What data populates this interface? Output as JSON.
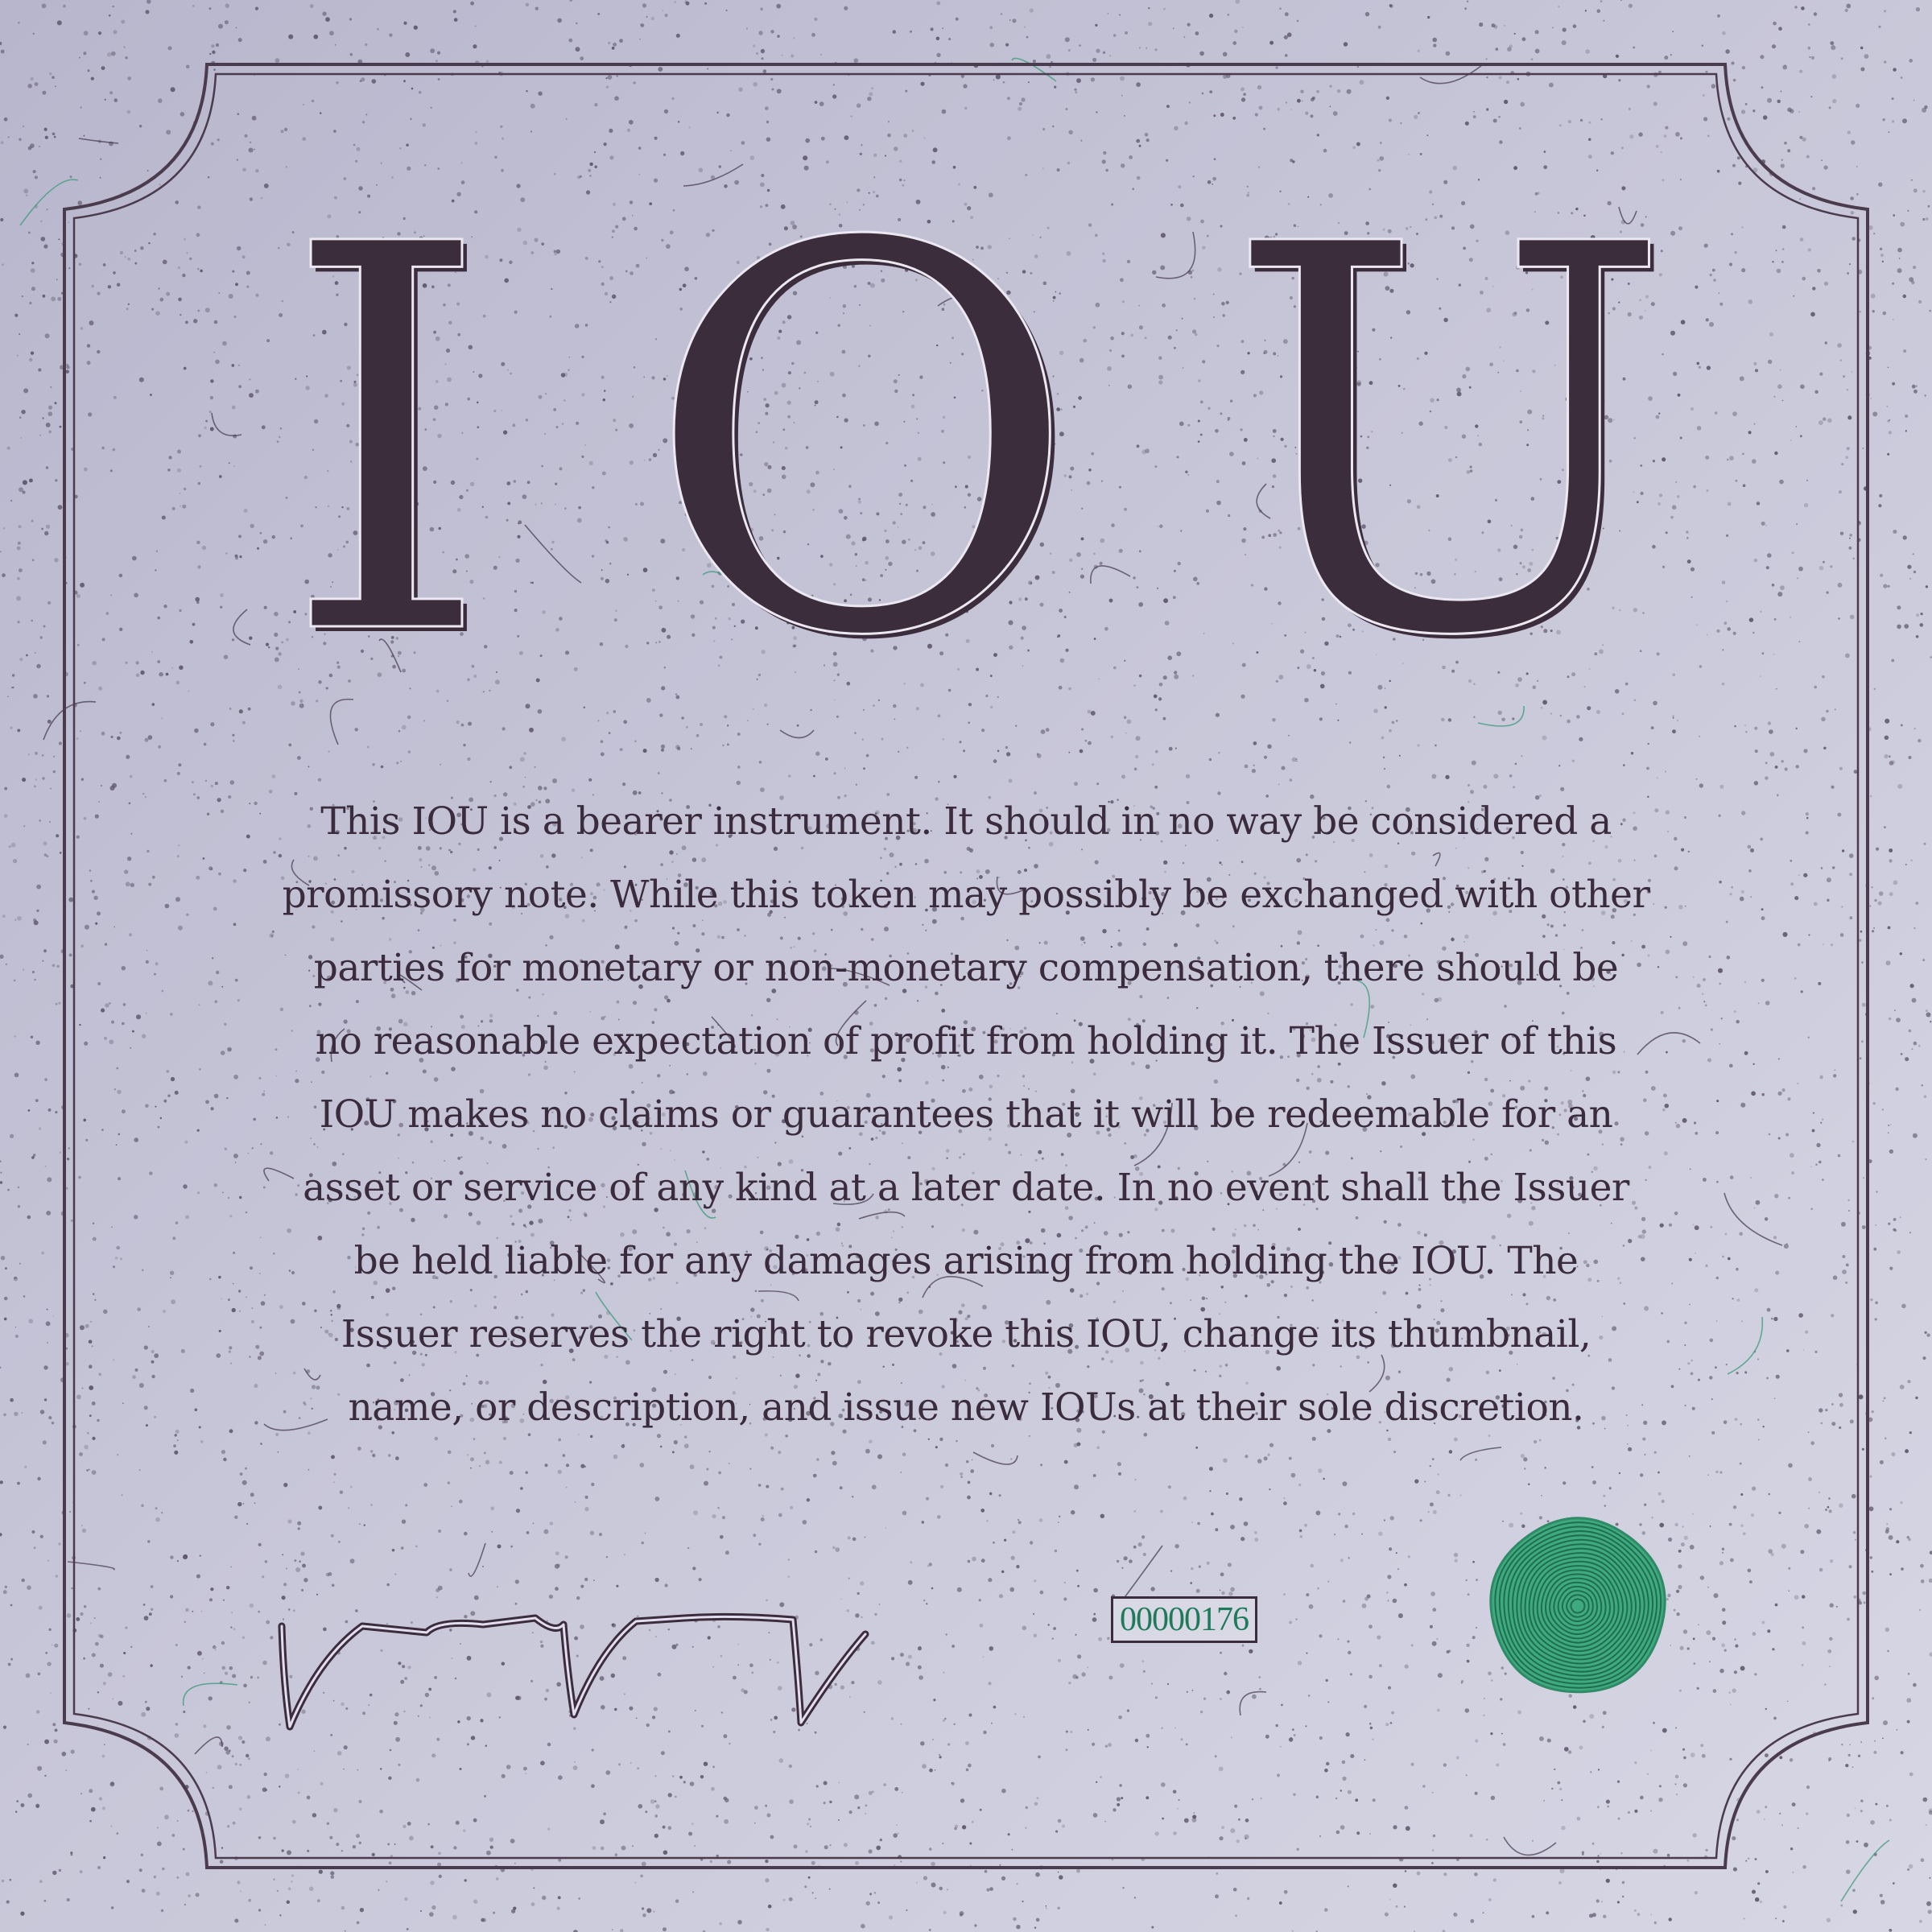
{
  "title": {
    "letters": [
      "I",
      "O",
      "U"
    ]
  },
  "disclaimer": {
    "lines": [
      "This IOU is a bearer instrument. It should in no way be considered a",
      "promissory note. While this token may possibly be exchanged with other",
      "parties for monetary or non-monetary compensation, there should be",
      "no reasonable expectation of profit from holding it. The Issuer of this",
      "IOU makes no claims or guarantees that it will be redeemable for an",
      "asset or service of any kind at a later date. In no event shall the Issuer",
      "be held liable for any damages arising from holding the IOU. The",
      "Issuer reserves the right to revoke this IOU, change its thumbnail,",
      "name, or description, and issue new IOUs at their sole discretion."
    ]
  },
  "serial_number": "00000176",
  "colors": {
    "ink": "#3c2d3d",
    "background": "#c6c5d8",
    "seal": "#3faa80",
    "fiber_green": "#3a9a78"
  },
  "icons": {
    "signature": "handwritten-signature",
    "seal": "green-concentric-pentagon-seal"
  }
}
